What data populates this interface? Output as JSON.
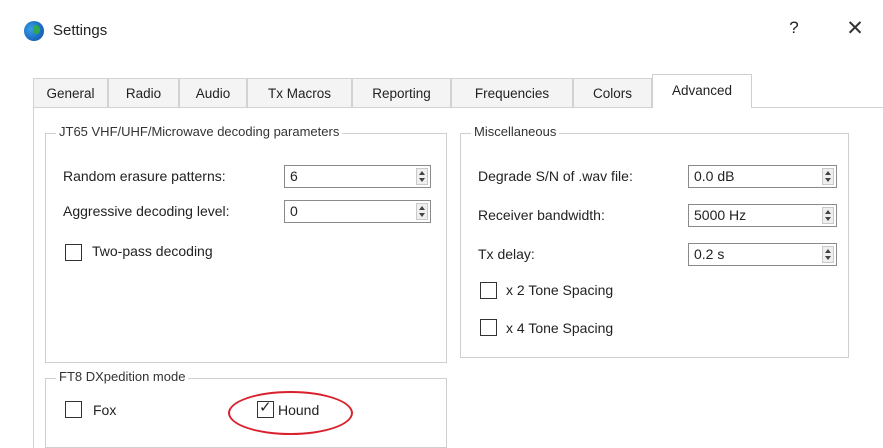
{
  "window": {
    "title": "Settings",
    "help_label": "?",
    "close_label": "✕",
    "app_icon": "globe-icon"
  },
  "tabs": [
    {
      "label": "General",
      "active": false
    },
    {
      "label": "Radio",
      "active": false
    },
    {
      "label": "Audio",
      "active": false
    },
    {
      "label": "Tx Macros",
      "active": false
    },
    {
      "label": "Reporting",
      "active": false
    },
    {
      "label": "Frequencies",
      "active": false
    },
    {
      "label": "Colors",
      "active": false
    },
    {
      "label": "Advanced",
      "active": true
    }
  ],
  "jt65": {
    "title": "JT65 VHF/UHF/Microwave decoding parameters",
    "random_erasure_label": "Random erasure patterns:",
    "random_erasure_value": "6",
    "aggressive_label": "Aggressive decoding level:",
    "aggressive_value": "0",
    "two_pass_label": "Two-pass decoding",
    "two_pass_checked": false
  },
  "misc": {
    "title": "Miscellaneous",
    "degrade_label": "Degrade S/N of .wav file:",
    "degrade_value": "0.0 dB",
    "bandwidth_label": "Receiver bandwidth:",
    "bandwidth_value": "5000 Hz",
    "txdelay_label": "Tx delay:",
    "txdelay_value": "0.2 s",
    "x2_label": "x 2 Tone Spacing",
    "x2_checked": false,
    "x4_label": "x 4 Tone Spacing",
    "x4_checked": false
  },
  "ft8": {
    "title": "FT8 DXpedition mode",
    "fox_label": "Fox",
    "fox_checked": false,
    "hound_label": "Hound",
    "hound_checked": true,
    "check_glyph": "✓"
  },
  "colors": {
    "highlight": "#d9212d"
  }
}
